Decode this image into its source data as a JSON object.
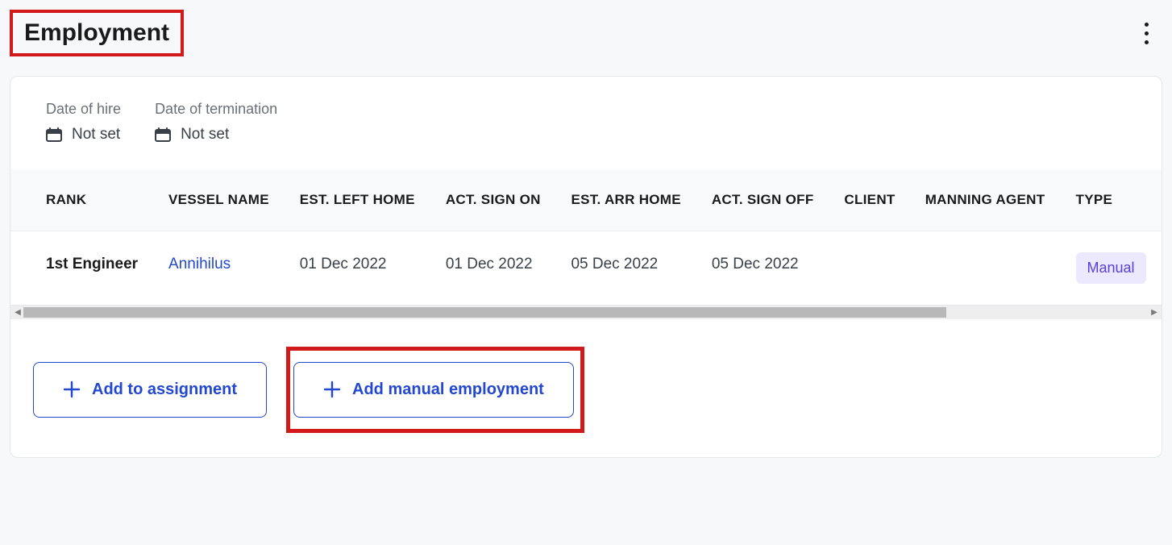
{
  "header": {
    "title": "Employment"
  },
  "info": {
    "hire_label": "Date of hire",
    "hire_value": "Not set",
    "termination_label": "Date of termination",
    "termination_value": "Not set"
  },
  "table": {
    "headers": {
      "rank": "RANK",
      "vessel": "VESSEL NAME",
      "est_left": "EST. LEFT HOME",
      "act_sign_on": "ACT. SIGN ON",
      "est_arr": "EST. ARR HOME",
      "act_sign_off": "ACT. SIGN OFF",
      "client": "CLIENT",
      "manning": "MANNING AGENT",
      "type": "TYPE"
    },
    "rows": [
      {
        "rank": "1st Engineer",
        "vessel": "Annihilus",
        "est_left": "01 Dec 2022",
        "act_sign_on": "01 Dec 2022",
        "est_arr": "05 Dec 2022",
        "act_sign_off": "05 Dec 2022",
        "client": "",
        "manning": "",
        "type": "Manual"
      }
    ]
  },
  "actions": {
    "add_assignment": "Add to assignment",
    "add_manual": "Add manual employment"
  }
}
